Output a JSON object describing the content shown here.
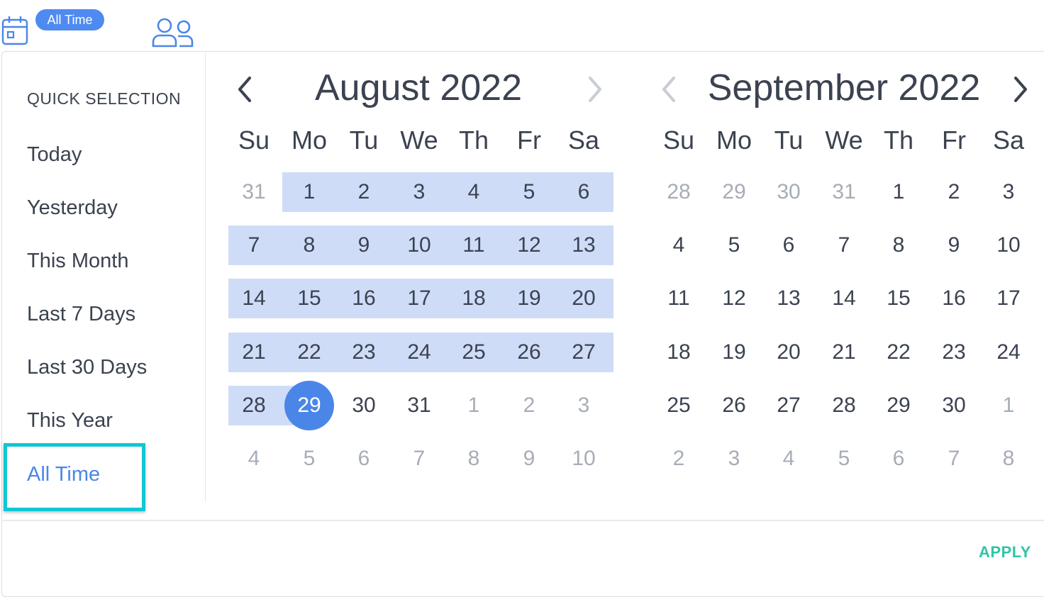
{
  "header": {
    "badge_label": "All Time",
    "icons": [
      "calendar-icon",
      "users-icon"
    ]
  },
  "sidebar": {
    "title": "QUICK SELECTION",
    "items": [
      {
        "label": "Today"
      },
      {
        "label": "Yesterday"
      },
      {
        "label": "This Month"
      },
      {
        "label": "Last 7 Days"
      },
      {
        "label": "Last 30 Days"
      },
      {
        "label": "This Year"
      },
      {
        "label": "All Time",
        "active": true
      }
    ]
  },
  "calendars": {
    "weekdays": [
      "Su",
      "Mo",
      "Tu",
      "We",
      "Th",
      "Fr",
      "Sa"
    ],
    "months": [
      {
        "title": "August 2022",
        "prev_enabled": true,
        "next_enabled": false,
        "weeks": [
          [
            "31",
            "1",
            "2",
            "3",
            "4",
            "5",
            "6"
          ],
          [
            "7",
            "8",
            "9",
            "10",
            "11",
            "12",
            "13"
          ],
          [
            "14",
            "15",
            "16",
            "17",
            "18",
            "19",
            "20"
          ],
          [
            "21",
            "22",
            "23",
            "24",
            "25",
            "26",
            "27"
          ],
          [
            "28",
            "29",
            "30",
            "31",
            "1",
            "2",
            "3"
          ],
          [
            "4",
            "5",
            "6",
            "7",
            "8",
            "9",
            "10"
          ]
        ],
        "outside_days": [
          [
            0,
            0
          ],
          [
            4,
            4
          ],
          [
            4,
            5
          ],
          [
            4,
            6
          ],
          [
            5,
            0
          ],
          [
            5,
            1
          ],
          [
            5,
            2
          ],
          [
            5,
            3
          ],
          [
            5,
            4
          ],
          [
            5,
            5
          ],
          [
            5,
            6
          ]
        ],
        "range_start": [
          0,
          1
        ],
        "range_end": [
          4,
          1
        ],
        "selected": [
          4,
          1
        ]
      },
      {
        "title": "September 2022",
        "prev_enabled": false,
        "next_enabled": true,
        "weeks": [
          [
            "28",
            "29",
            "30",
            "31",
            "1",
            "2",
            "3"
          ],
          [
            "4",
            "5",
            "6",
            "7",
            "8",
            "9",
            "10"
          ],
          [
            "11",
            "12",
            "13",
            "14",
            "15",
            "16",
            "17"
          ],
          [
            "18",
            "19",
            "20",
            "21",
            "22",
            "23",
            "24"
          ],
          [
            "25",
            "26",
            "27",
            "28",
            "29",
            "30",
            "1"
          ],
          [
            "2",
            "3",
            "4",
            "5",
            "6",
            "7",
            "8"
          ]
        ],
        "outside_days": [
          [
            0,
            0
          ],
          [
            0,
            1
          ],
          [
            0,
            2
          ],
          [
            0,
            3
          ],
          [
            4,
            6
          ],
          [
            5,
            0
          ],
          [
            5,
            1
          ],
          [
            5,
            2
          ],
          [
            5,
            3
          ],
          [
            5,
            4
          ],
          [
            5,
            5
          ],
          [
            5,
            6
          ]
        ],
        "range_start": null,
        "range_end": null,
        "selected": null
      }
    ]
  },
  "footer": {
    "apply_label": "APPLY"
  },
  "colors": {
    "accent": "#4a86e8",
    "range_fill": "#cfdcf8",
    "apply": "#30c5a5",
    "highlight_box": "#12c6d3"
  }
}
